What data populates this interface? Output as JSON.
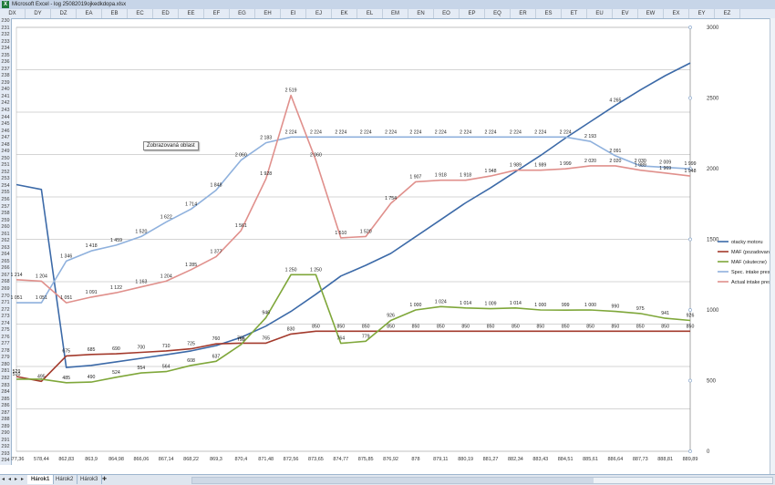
{
  "window": {
    "title": "Microsoft Excel - log 25082019ojkedkdopa.xlsx",
    "app_icon": "excel-icon"
  },
  "columns": [
    "DX",
    "DY",
    "DZ",
    "EA",
    "EB",
    "EC",
    "ED",
    "EE",
    "EF",
    "EG",
    "EH",
    "EI",
    "EJ",
    "EK",
    "EL",
    "EM",
    "EN",
    "EO",
    "EP",
    "EQ",
    "ER",
    "ES",
    "ET",
    "EU",
    "EV",
    "EW",
    "EX",
    "EY",
    "EZ"
  ],
  "rows": [
    "230",
    "231",
    "232",
    "233",
    "234",
    "235",
    "236",
    "237",
    "238",
    "239",
    "240",
    "241",
    "242",
    "243",
    "244",
    "245",
    "246",
    "247",
    "248",
    "249",
    "250",
    "251",
    "252",
    "253",
    "254",
    "255",
    "256",
    "257",
    "258",
    "259",
    "260",
    "261",
    "262",
    "263",
    "264",
    "265",
    "266",
    "267",
    "268",
    "269",
    "270",
    "271",
    "272",
    "273",
    "274",
    "275",
    "276",
    "277",
    "278",
    "279",
    "280",
    "281",
    "282",
    "283",
    "284",
    "285",
    "286",
    "287",
    "288",
    "289",
    "290",
    "291",
    "292",
    "293",
    "294"
  ],
  "tooltip": "Zobrazovaná oblast",
  "sheet_tabs": [
    "Hárok1",
    "Hárok2",
    "Hárok3"
  ],
  "active_tab": "Hárok1",
  "chart_data": {
    "type": "line",
    "x": [
      "877,36",
      "578,44",
      "862,83",
      "863,9",
      "864,98",
      "866,06",
      "867,14",
      "868,22",
      "869,3",
      "870,4",
      "871,48",
      "872,56",
      "873,65",
      "874,77",
      "875,85",
      "876,92",
      "878",
      "879,11",
      "880,19",
      "881,27",
      "882,34",
      "883,43",
      "884,51",
      "885,61",
      "886,64",
      "887,73",
      "888,81",
      "889,89"
    ],
    "right_axis": {
      "ticks": [
        "0",
        "500",
        "1000",
        "1500",
        "2000",
        "2500",
        "3000"
      ],
      "ylim": [
        0,
        3000
      ]
    },
    "legend_position": "right",
    "series": [
      {
        "name": "otacky motoru",
        "color": "#3c6aa8",
        "values": [
          1887,
          1853,
          593,
          608,
          633,
          658,
          683,
          710,
          748,
          806,
          886,
          990,
          1111,
          1240,
          1316,
          1400,
          1519,
          1638,
          1758,
          1864,
          1979,
          2093,
          2216,
          2332,
          2448,
          2557,
          2658,
          2748
        ],
        "labels": [
          null,
          null,
          null,
          null,
          null,
          null,
          null,
          null,
          null,
          null,
          null,
          null,
          null,
          null,
          null,
          null,
          null,
          null,
          null,
          null,
          null,
          null,
          null,
          null,
          "4 265",
          null,
          null,
          null
        ]
      },
      {
        "name": "MAF (pozadovano)",
        "color": "#a33a2c",
        "values": [
          529,
          495,
          675,
          685,
          690,
          700,
          710,
          725,
          760,
          765,
          765,
          830,
          850,
          850,
          850,
          850,
          850,
          850,
          850,
          850,
          850,
          850,
          850,
          850,
          850,
          850,
          850,
          850
        ],
        "labels": [
          "529",
          "495",
          "675",
          "685",
          "690",
          "700",
          "710",
          "725",
          "760",
          "765",
          "765",
          "830",
          "850",
          "850",
          "850",
          "850",
          "850",
          "850",
          "850",
          "850",
          "850",
          "850",
          "850",
          "850",
          "850",
          "850",
          "850",
          "850"
        ]
      },
      {
        "name": "MAF (skutecne)",
        "color": "#7fa73a",
        "values": [
          510,
          510,
          485,
          490,
          524,
          554,
          564,
          608,
          637,
          755,
          946,
          1250,
          1250,
          764,
          779,
          926,
          1000,
          1024,
          1014,
          1009,
          1014,
          1000,
          999,
          1000,
          990,
          975,
          941,
          926
        ],
        "labels": [
          "510",
          null,
          "485",
          "490",
          "524",
          "554",
          "564",
          "608",
          "637",
          "755",
          "946",
          "1 250",
          "1 250",
          "764",
          "779",
          "926",
          "1 000",
          "1 024",
          "1 014",
          "1 009",
          "1 014",
          "1 000",
          "999",
          "1 000",
          "990",
          "975",
          "941",
          "926"
        ]
      },
      {
        "name": "Spec. intake press.",
        "color": "#8fb1dd",
        "values": [
          1051,
          1051,
          1346,
          1418,
          1459,
          1520,
          1622,
          1714,
          1848,
          2060,
          2183,
          2224,
          2224,
          2224,
          2224,
          2224,
          2224,
          2224,
          2224,
          2224,
          2224,
          2224,
          2224,
          2193,
          2091,
          2020,
          2009,
          1999
        ],
        "labels": [
          "1 051",
          "1 051",
          "1 346",
          "1 418",
          "1 459",
          "1 520",
          "1 622",
          "1 714",
          "1 848",
          "2 060",
          "2 183",
          "2 224",
          "2 224",
          "2 224",
          "2 224",
          "2 224",
          "2 224",
          "2 224",
          "2 224",
          "2 224",
          "2 224",
          "2 224",
          "2 224",
          "2 193",
          "2 091",
          "2 030",
          "2 009",
          "1 999"
        ]
      },
      {
        "name": "Actual intake press.",
        "color": "#e0908c",
        "values": [
          1214,
          1204,
          1051,
          1091,
          1122,
          1163,
          1204,
          1285,
          1377,
          1561,
          1928,
          2519,
          2060,
          1510,
          1520,
          1754,
          1907,
          1918,
          1918,
          1948,
          1989,
          1989,
          1999,
          2020,
          2020,
          1989,
          1969,
          1948
        ],
        "labels": [
          "1 214",
          "1 204",
          "1 051",
          "1 091",
          "1 122",
          "1 163",
          "1 204",
          "1 285",
          "1 377",
          "1 561",
          "1 928",
          "2 519",
          "2 060",
          "1 510",
          "1 520",
          "1 754",
          "1 907",
          "1 918",
          "1 918",
          "1 948",
          "1 989",
          "1 989",
          "1 999",
          "2 020",
          "2 020",
          "1 989",
          "1 969",
          "1 948"
        ]
      }
    ]
  }
}
